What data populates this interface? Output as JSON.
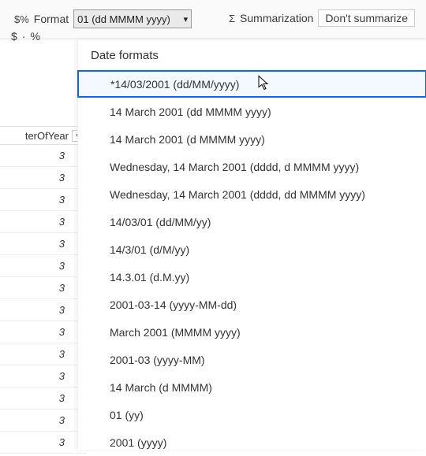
{
  "ribbon": {
    "format_label": "Format",
    "format_value": "01 (dd MMMM yyyy)",
    "summarization_label": "Summarization",
    "summarization_button": "Don't summarize",
    "currency_icon": "$",
    "percent_icon": "%",
    "spct_icon": "$%",
    "sigma_icon": "Σ",
    "dot_icon": "·"
  },
  "grid": {
    "header": "terOfYear",
    "rows": [
      "3",
      "3",
      "3",
      "3",
      "3",
      "3",
      "3",
      "3",
      "3",
      "3",
      "3",
      "3",
      "3",
      "3"
    ]
  },
  "dropdown": {
    "header": "Date formats",
    "items": [
      "*14/03/2001 (dd/MM/yyyy)",
      "14 March 2001 (dd MMMM yyyy)",
      "14 March 2001 (d MMMM yyyy)",
      "Wednesday, 14 March 2001 (dddd, d MMMM yyyy)",
      "Wednesday, 14 March 2001 (dddd, dd MMMM yyyy)",
      "14/03/01 (dd/MM/yy)",
      "14/3/01 (d/M/yy)",
      "14.3.01 (d.M.yy)",
      "2001-03-14 (yyyy-MM-dd)",
      "March 2001 (MMMM yyyy)",
      "2001-03 (yyyy-MM)",
      "14 March (d MMMM)",
      "01 (yy)",
      "2001 (yyyy)"
    ],
    "selected_index": 0
  }
}
